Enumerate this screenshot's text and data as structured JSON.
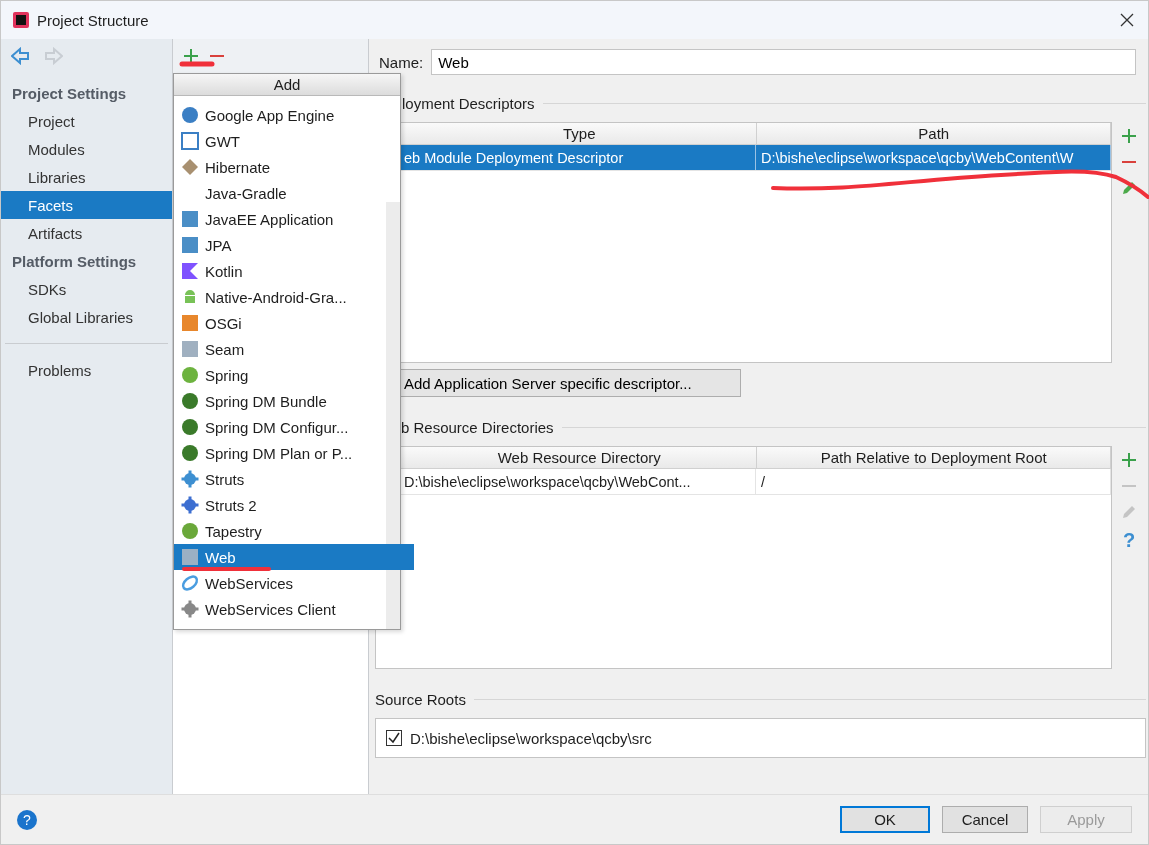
{
  "window": {
    "title": "Project Structure"
  },
  "nav": [
    {
      "kind": "back",
      "disabled": false
    },
    {
      "kind": "forward",
      "disabled": true
    }
  ],
  "sidebar": {
    "sections": [
      {
        "heading": "Project Settings",
        "items": [
          {
            "label": "Project",
            "selected": false
          },
          {
            "label": "Modules",
            "selected": false
          },
          {
            "label": "Libraries",
            "selected": false
          },
          {
            "label": "Facets",
            "selected": true
          },
          {
            "label": "Artifacts",
            "selected": false
          }
        ]
      },
      {
        "heading": "Platform Settings",
        "items": [
          {
            "label": "SDKs",
            "selected": false
          },
          {
            "label": "Global Libraries",
            "selected": false
          }
        ]
      }
    ],
    "extra_items": [
      {
        "label": "Problems",
        "selected": false
      }
    ]
  },
  "add_menu": {
    "title": "Add",
    "items": [
      {
        "label": "Google App Engine",
        "selected": false
      },
      {
        "label": "GWT",
        "selected": false
      },
      {
        "label": "Hibernate",
        "selected": false
      },
      {
        "label": "Java-Gradle",
        "selected": false
      },
      {
        "label": "JavaEE Application",
        "selected": false
      },
      {
        "label": "JPA",
        "selected": false
      },
      {
        "label": "Kotlin",
        "selected": false
      },
      {
        "label": "Native-Android-Gra...",
        "selected": false
      },
      {
        "label": "OSGi",
        "selected": false
      },
      {
        "label": "Seam",
        "selected": false
      },
      {
        "label": "Spring",
        "selected": false
      },
      {
        "label": "Spring DM Bundle",
        "selected": false
      },
      {
        "label": "Spring DM Configur...",
        "selected": false
      },
      {
        "label": "Spring DM Plan or P...",
        "selected": false
      },
      {
        "label": "Struts",
        "selected": false
      },
      {
        "label": "Struts 2",
        "selected": false
      },
      {
        "label": "Tapestry",
        "selected": false
      },
      {
        "label": "Web",
        "selected": true
      },
      {
        "label": "WebServices",
        "selected": false
      },
      {
        "label": "WebServices Client",
        "selected": false
      }
    ]
  },
  "name_field": {
    "label": "Name:",
    "value": "Web"
  },
  "deployment_descriptors": {
    "title": "loyment Descriptors",
    "columns": [
      "Type",
      "Path"
    ],
    "rows": [
      {
        "cells": [
          "eb Module Deployment Descriptor",
          "D:\\bishe\\eclipse\\workspace\\qcby\\WebContent\\W"
        ],
        "selected": true
      }
    ],
    "tools": [
      {
        "kind": "add",
        "disabled": false
      },
      {
        "kind": "remove",
        "disabled": false
      },
      {
        "kind": "edit",
        "disabled": false
      }
    ]
  },
  "server_button": {
    "label": "Add Application Server specific descriptor..."
  },
  "web_resource_directories": {
    "title": "b Resource Directories",
    "columns": [
      "Web Resource Directory",
      "Path Relative to Deployment Root"
    ],
    "rows": [
      {
        "cells": [
          "D:\\bishe\\eclipse\\workspace\\qcby\\WebCont...",
          "/"
        ],
        "selected": false
      }
    ],
    "tools": [
      {
        "kind": "add",
        "disabled": false
      },
      {
        "kind": "remove",
        "disabled": true
      },
      {
        "kind": "edit",
        "disabled": true
      },
      {
        "kind": "help",
        "disabled": false,
        "glyph": "?"
      }
    ]
  },
  "source_roots": {
    "title": "Source Roots",
    "items": [
      {
        "label": "D:\\bishe\\eclipse\\workspace\\qcby\\src",
        "checked": true
      }
    ]
  },
  "help_button": {
    "glyph": "?"
  },
  "buttons": [
    {
      "label": "OK",
      "kind": "default",
      "disabled": false
    },
    {
      "label": "Cancel",
      "kind": "normal",
      "disabled": false
    },
    {
      "label": "Apply",
      "kind": "normal",
      "disabled": true
    }
  ]
}
